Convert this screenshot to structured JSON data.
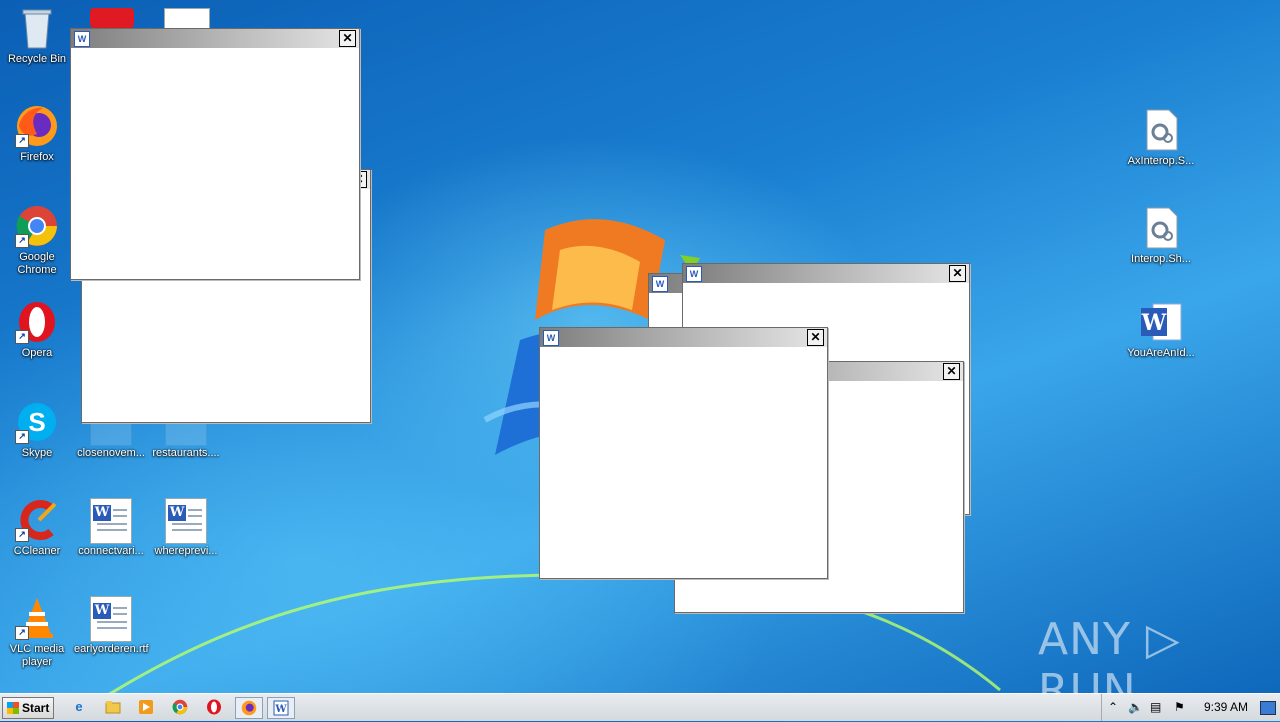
{
  "desktop": {
    "icons": [
      {
        "label": "Recycle Bin"
      },
      {
        "label": "Firefox"
      },
      {
        "label": "Google Chrome"
      },
      {
        "label": "Opera"
      },
      {
        "label": "Skype"
      },
      {
        "label": "CCleaner"
      },
      {
        "label": "VLC media player"
      },
      {
        "label": "closenovem..."
      },
      {
        "label": "restaurants...."
      },
      {
        "label": "connectvari..."
      },
      {
        "label": "whereprevi..."
      },
      {
        "label": "earlyorderen.rtf"
      },
      {
        "label": "AxInterop.S..."
      },
      {
        "label": "Interop.Sh..."
      },
      {
        "label": "YouAreAnId..."
      }
    ]
  },
  "windows": {
    "close_glyph": "✕",
    "doc_glyph": "W"
  },
  "taskbar": {
    "start_label": "Start",
    "clock": "9:39 AM",
    "quick_icons": [
      "internet-explorer-icon",
      "explorer-icon",
      "media-player-icon",
      "chrome-icon",
      "opera-icon",
      "firefox-icon",
      "word-icon"
    ]
  },
  "watermark": "ANY ▷ RUN"
}
